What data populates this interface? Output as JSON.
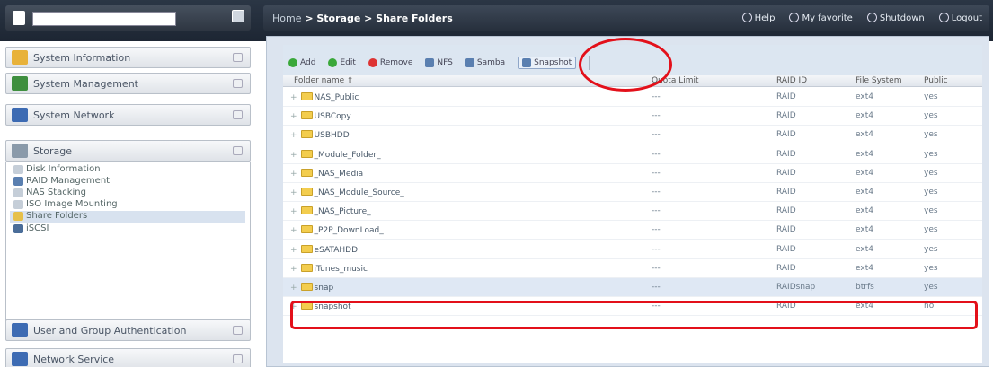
{
  "topbar": {
    "search_placeholder": "",
    "breadcrumb_home": "Home",
    "breadcrumb_rest": " > Storage > Share Folders",
    "links": [
      "Help",
      "My favorite",
      "Shutdown",
      "Logout"
    ]
  },
  "sidebar": {
    "headers_top": [
      {
        "label": "System Information",
        "icon": "info-icon",
        "color": "#e8b23a"
      },
      {
        "label": "System Management",
        "icon": "tools-icon",
        "color": "#3f8f3f"
      },
      {
        "label": "System Network",
        "icon": "network-icon",
        "color": "#3d6bb3"
      },
      {
        "label": "Storage",
        "icon": "storage-icon",
        "color": "#8a9aaa"
      }
    ],
    "items": [
      {
        "label": "Disk Information",
        "icon": "disk-icon",
        "color": "#c5ced8"
      },
      {
        "label": "RAID Management",
        "icon": "raid-icon",
        "color": "#5a7fb0"
      },
      {
        "label": "NAS Stacking",
        "icon": "stacking-icon",
        "color": "#c5ced8"
      },
      {
        "label": "ISO Image Mounting",
        "icon": "iso-icon",
        "color": "#c5ced8"
      },
      {
        "label": "Share Folders",
        "icon": "share-folder-icon",
        "color": "#e6c04a"
      },
      {
        "label": "iSCSI",
        "icon": "iscsi-icon",
        "color": "#4a6d99"
      }
    ],
    "headers_bottom": [
      {
        "label": "User and Group Authentication",
        "icon": "users-icon",
        "color": "#3d6bb3"
      },
      {
        "label": "Network Service",
        "icon": "network-service-icon",
        "color": "#3d6bb3"
      }
    ]
  },
  "toolbar": {
    "buttons": [
      {
        "label": "Add",
        "icon": "add-icon",
        "color": "#3aa83a"
      },
      {
        "label": "Edit",
        "icon": "edit-icon",
        "color": "#3aa83a"
      },
      {
        "label": "Remove",
        "icon": "remove-icon",
        "color": "#d33"
      },
      {
        "label": "NFS",
        "icon": "nfs-icon",
        "color": "#5a7fb0"
      },
      {
        "label": "Samba",
        "icon": "samba-icon",
        "color": "#5a7fb0"
      },
      {
        "label": "Snapshot",
        "icon": "snapshot-icon",
        "color": "#5a7fb0"
      }
    ]
  },
  "grid": {
    "columns": [
      "Folder name ⇧",
      "Quota Limit",
      "RAID ID",
      "File System",
      "Public"
    ],
    "rows": [
      {
        "name": "NAS_Public",
        "quota": "---",
        "raid": "RAID",
        "fs": "ext4",
        "public": "yes"
      },
      {
        "name": "USBCopy",
        "quota": "---",
        "raid": "RAID",
        "fs": "ext4",
        "public": "yes"
      },
      {
        "name": "USBHDD",
        "quota": "---",
        "raid": "RAID",
        "fs": "ext4",
        "public": "yes"
      },
      {
        "name": "_Module_Folder_",
        "quota": "---",
        "raid": "RAID",
        "fs": "ext4",
        "public": "yes"
      },
      {
        "name": "_NAS_Media",
        "quota": "---",
        "raid": "RAID",
        "fs": "ext4",
        "public": "yes"
      },
      {
        "name": "_NAS_Module_Source_",
        "quota": "---",
        "raid": "RAID",
        "fs": "ext4",
        "public": "yes"
      },
      {
        "name": "_NAS_Picture_",
        "quota": "---",
        "raid": "RAID",
        "fs": "ext4",
        "public": "yes"
      },
      {
        "name": "_P2P_DownLoad_",
        "quota": "---",
        "raid": "RAID",
        "fs": "ext4",
        "public": "yes"
      },
      {
        "name": "eSATAHDD",
        "quota": "---",
        "raid": "RAID",
        "fs": "ext4",
        "public": "yes"
      },
      {
        "name": "iTunes_music",
        "quota": "---",
        "raid": "RAID",
        "fs": "ext4",
        "public": "yes"
      },
      {
        "name": "snap",
        "quota": "---",
        "raid": "RAIDsnap",
        "fs": "btrfs",
        "public": "yes"
      },
      {
        "name": "snapshot",
        "quota": "---",
        "raid": "RAID",
        "fs": "ext4",
        "public": "no"
      }
    ]
  }
}
